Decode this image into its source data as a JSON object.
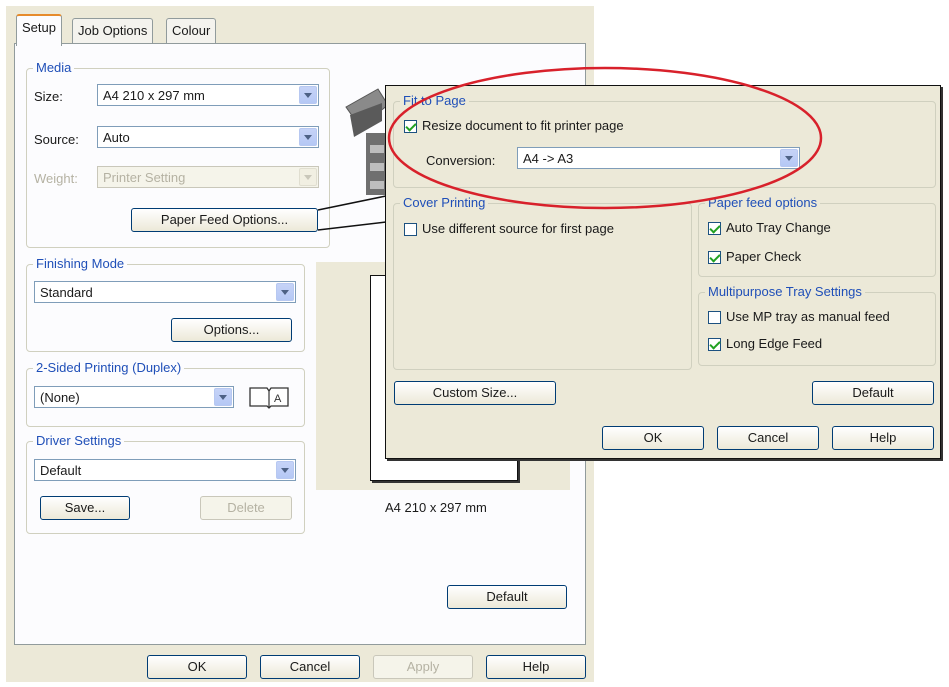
{
  "tabs": [
    "Setup",
    "Job Options",
    "Colour"
  ],
  "media": {
    "legend": "Media",
    "size_label": "Size:",
    "size_value": "A4 210 x 297 mm",
    "source_label": "Source:",
    "source_value": "Auto",
    "weight_label": "Weight:",
    "weight_value": "Printer Setting",
    "paper_feed_button": "Paper Feed Options..."
  },
  "finishing": {
    "legend": "Finishing Mode",
    "value": "Standard",
    "options_button": "Options..."
  },
  "duplex": {
    "legend": "2-Sided Printing (Duplex)",
    "value": "(None)"
  },
  "driver": {
    "legend": "Driver Settings",
    "value": "Default",
    "save_button": "Save...",
    "delete_button": "Delete"
  },
  "preview": {
    "caption": "A4 210 x 297 mm"
  },
  "main_buttons": {
    "default": "Default",
    "ok": "OK",
    "cancel": "Cancel",
    "apply": "Apply",
    "help": "Help"
  },
  "popup": {
    "fit_legend": "Fit to Page",
    "resize_label": "Resize document to fit printer page",
    "resize_checked": true,
    "conversion_label": "Conversion:",
    "conversion_value": "A4 -> A3",
    "cover_legend": "Cover Printing",
    "cover_label": "Use different source for first page",
    "cover_checked": false,
    "paper_feed_legend": "Paper feed options",
    "auto_tray_label": "Auto Tray Change",
    "auto_tray_checked": true,
    "paper_check_label": "Paper Check",
    "paper_check_checked": true,
    "mp_legend": "Multipurpose Tray Settings",
    "mp_manual_label": "Use MP tray as manual feed",
    "mp_manual_checked": false,
    "long_edge_label": "Long Edge Feed",
    "long_edge_checked": true,
    "custom_size_button": "Custom Size...",
    "default_button": "Default",
    "ok_button": "OK",
    "cancel_button": "Cancel",
    "help_button": "Help"
  },
  "colors": {
    "dialog_bg": "#ece9d8",
    "legend_blue": "#1f4fb8",
    "highlight_red": "#d8212b"
  }
}
